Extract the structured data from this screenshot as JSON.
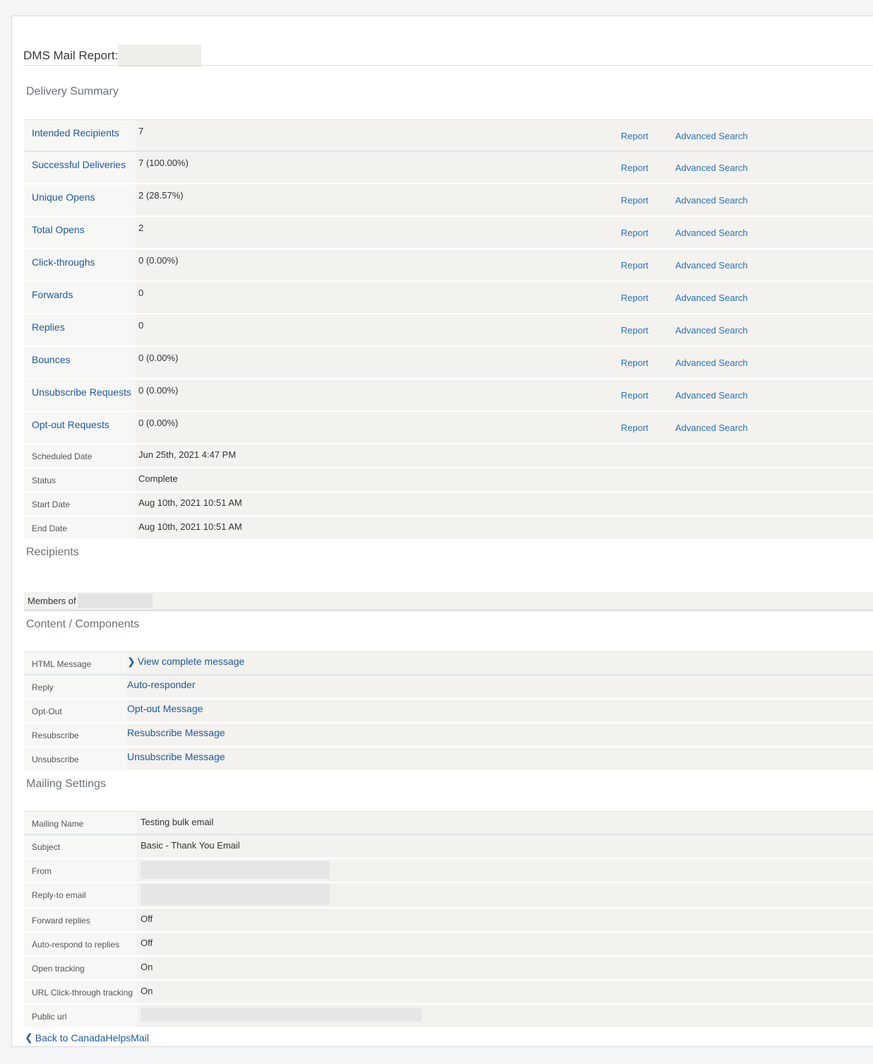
{
  "header": {
    "title": "DMS Mail Report:"
  },
  "delivery_summary": {
    "heading": "Delivery Summary",
    "report_label": "Report",
    "advanced_label": "Advanced Search",
    "rows": [
      {
        "label": "Intended Recipients",
        "value": "7"
      },
      {
        "label": "Successful Deliveries",
        "value": "7 (100.00%)"
      },
      {
        "label": "Unique Opens",
        "value": "2 (28.57%)"
      },
      {
        "label": "Total Opens",
        "value": "2"
      },
      {
        "label": "Click-throughs",
        "value": "0 (0.00%)"
      },
      {
        "label": "Forwards",
        "value": "0"
      },
      {
        "label": "Replies",
        "value": "0"
      },
      {
        "label": "Bounces",
        "value": "0 (0.00%)"
      },
      {
        "label": "Unsubscribe Requests",
        "value": "0 (0.00%)"
      },
      {
        "label": "Opt-out Requests",
        "value": "0 (0.00%)"
      }
    ],
    "meta": [
      {
        "label": "Scheduled Date",
        "value": "Jun 25th, 2021 4:47 PM"
      },
      {
        "label": "Status",
        "value": "Complete"
      },
      {
        "label": "Start Date",
        "value": "Aug 10th, 2021 10:51 AM"
      },
      {
        "label": "End Date",
        "value": "Aug 10th, 2021 10:51 AM"
      }
    ]
  },
  "recipients": {
    "heading": "Recipients",
    "members_label": "Members of"
  },
  "content": {
    "heading": "Content / Components",
    "rows": [
      {
        "label": "HTML Message",
        "value": "View complete message"
      },
      {
        "label": "Reply",
        "value": "Auto-responder"
      },
      {
        "label": "Opt-Out",
        "value": "Opt-out Message"
      },
      {
        "label": "Resubscribe",
        "value": "Resubscribe Message"
      },
      {
        "label": "Unsubscribe",
        "value": "Unsubscribe Message"
      }
    ]
  },
  "mailing_settings": {
    "heading": "Mailing Settings",
    "rows": [
      {
        "label": "Mailing Name",
        "value": "Testing bulk email"
      },
      {
        "label": "Subject",
        "value": "Basic - Thank You Email"
      },
      {
        "label": "From",
        "value": ""
      },
      {
        "label": "Reply-to email",
        "value": ""
      },
      {
        "label": "Forward replies",
        "value": "Off"
      },
      {
        "label": "Auto-respond to replies",
        "value": "Off"
      },
      {
        "label": "Open tracking",
        "value": "On"
      },
      {
        "label": "URL Click-through tracking",
        "value": "On"
      },
      {
        "label": "Public url",
        "value": ""
      }
    ]
  },
  "footer": {
    "back_label": "Back to CanadaHelpsMail"
  }
}
